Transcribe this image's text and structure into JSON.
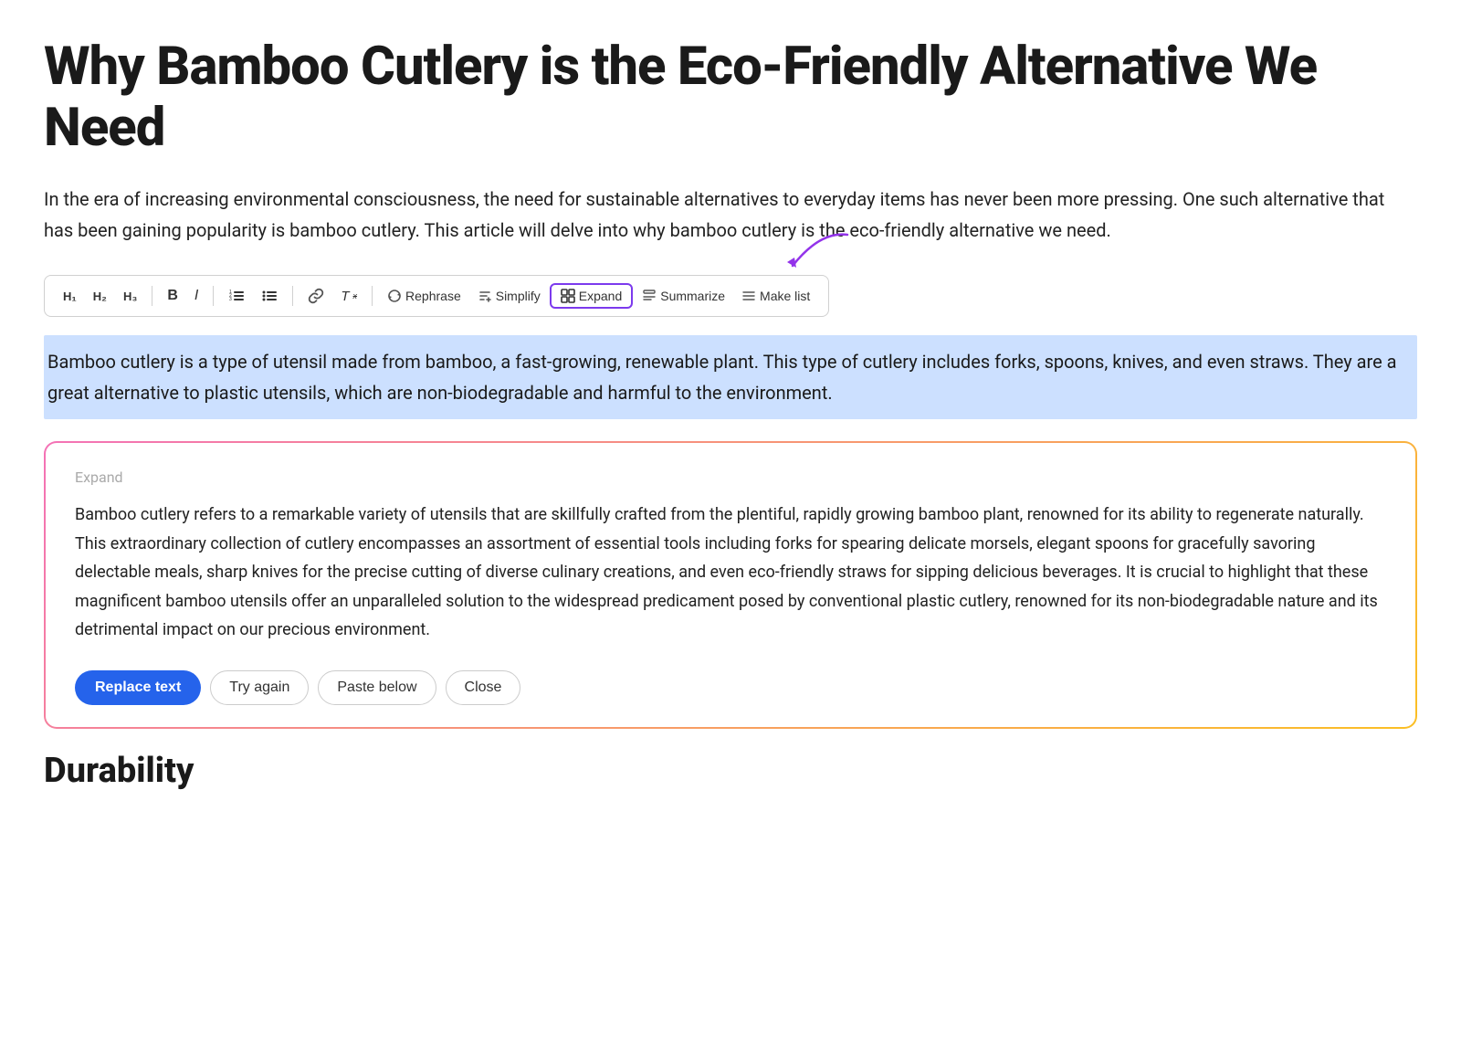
{
  "page": {
    "title": "Why Bamboo Cutlery is the Eco-Friendly Alternative We Need",
    "intro": "In the era of increasing environmental consciousness, the need for sustainable alternatives to everyday items has never been more pressing. One such alternative that has been gaining popularity is bamboo cutlery. This article will delve into why bamboo cutlery is the eco-friendly alternative we need."
  },
  "toolbar": {
    "h1": "H₁",
    "h2": "H₂",
    "h3": "H₃",
    "bold": "B",
    "italic": "I",
    "ordered_list": "≡",
    "unordered_list": "≡",
    "link": "🔗",
    "clear": "Ꞡ",
    "rephrase": "Rephrase",
    "simplify": "Simplify",
    "expand": "Expand",
    "summarize": "Summarize",
    "make_list": "Make list"
  },
  "selected_text": "Bamboo cutlery is a type of utensil made from bamboo, a fast-growing, renewable plant. This type of cutlery includes forks, spoons, knives, and even straws. They are a great alternative to plastic utensils, which are non-biodegradable and harmful to the environment.",
  "expand_box": {
    "label": "Expand",
    "content": "Bamboo cutlery refers to a remarkable variety of utensils that are skillfully crafted from the plentiful, rapidly growing bamboo plant, renowned for its ability to regenerate naturally. This extraordinary collection of cutlery encompasses an assortment of essential tools including forks for spearing delicate morsels, elegant spoons for gracefully savoring delectable meals, sharp knives for the precise cutting of diverse culinary creations, and even eco-friendly straws for sipping delicious beverages. It is crucial to highlight that these magnificent bamboo utensils offer an unparalleled solution to the widespread predicament posed by conventional plastic cutlery, renowned for its non-biodegradable nature and its detrimental impact on our precious environment."
  },
  "buttons": {
    "replace_text": "Replace text",
    "try_again": "Try again",
    "paste_below": "Paste below",
    "close": "Close"
  },
  "next_section": "Durability"
}
